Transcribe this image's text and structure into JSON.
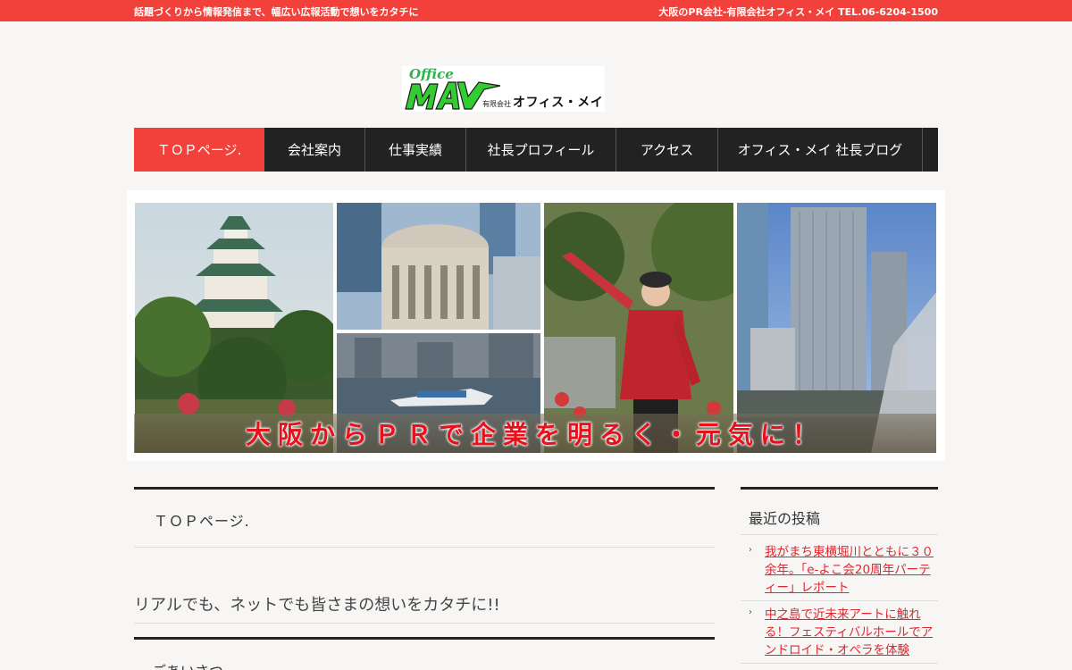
{
  "topbar": {
    "tagline": "話題づくりから情報発信まで、幅広い広報活動で想いをカタチに",
    "contact": "大阪のPR会社-有限会社オフィス・メイ TEL.06-6204-1500"
  },
  "logo": {
    "script": "Office",
    "company_type": "有限会社",
    "name": "オフィス・メイ",
    "accent": "#33cc33"
  },
  "nav": {
    "items": [
      {
        "label": "ＴＯＰページ."
      },
      {
        "label": "会社案内"
      },
      {
        "label": "仕事実績"
      },
      {
        "label": "社長プロフィール"
      },
      {
        "label": "アクセス"
      },
      {
        "label": "オフィス・メイ 社長ブログ"
      }
    ],
    "active_color": "#f2413a",
    "bar_color": "#222222"
  },
  "hero": {
    "caption": "大阪からＰＲで企業を明るく・元気に！"
  },
  "main": {
    "page_title": "ＴＯＰページ.",
    "lead": "リアルでも、ネットでも皆さまの想いをカタチに!!",
    "section_heading": "ごあいさつ"
  },
  "sidebar": {
    "title": "最近の投稿",
    "posts": [
      {
        "label": "我がまち東横堀川とともに３０余年。「e-よこ会20周年パーティー」レポート"
      },
      {
        "label": "中之島で近未来アートに触れる！フェスティバルホールでアンドロイド・オペラを体験"
      }
    ],
    "link_color": "#e0262e"
  }
}
